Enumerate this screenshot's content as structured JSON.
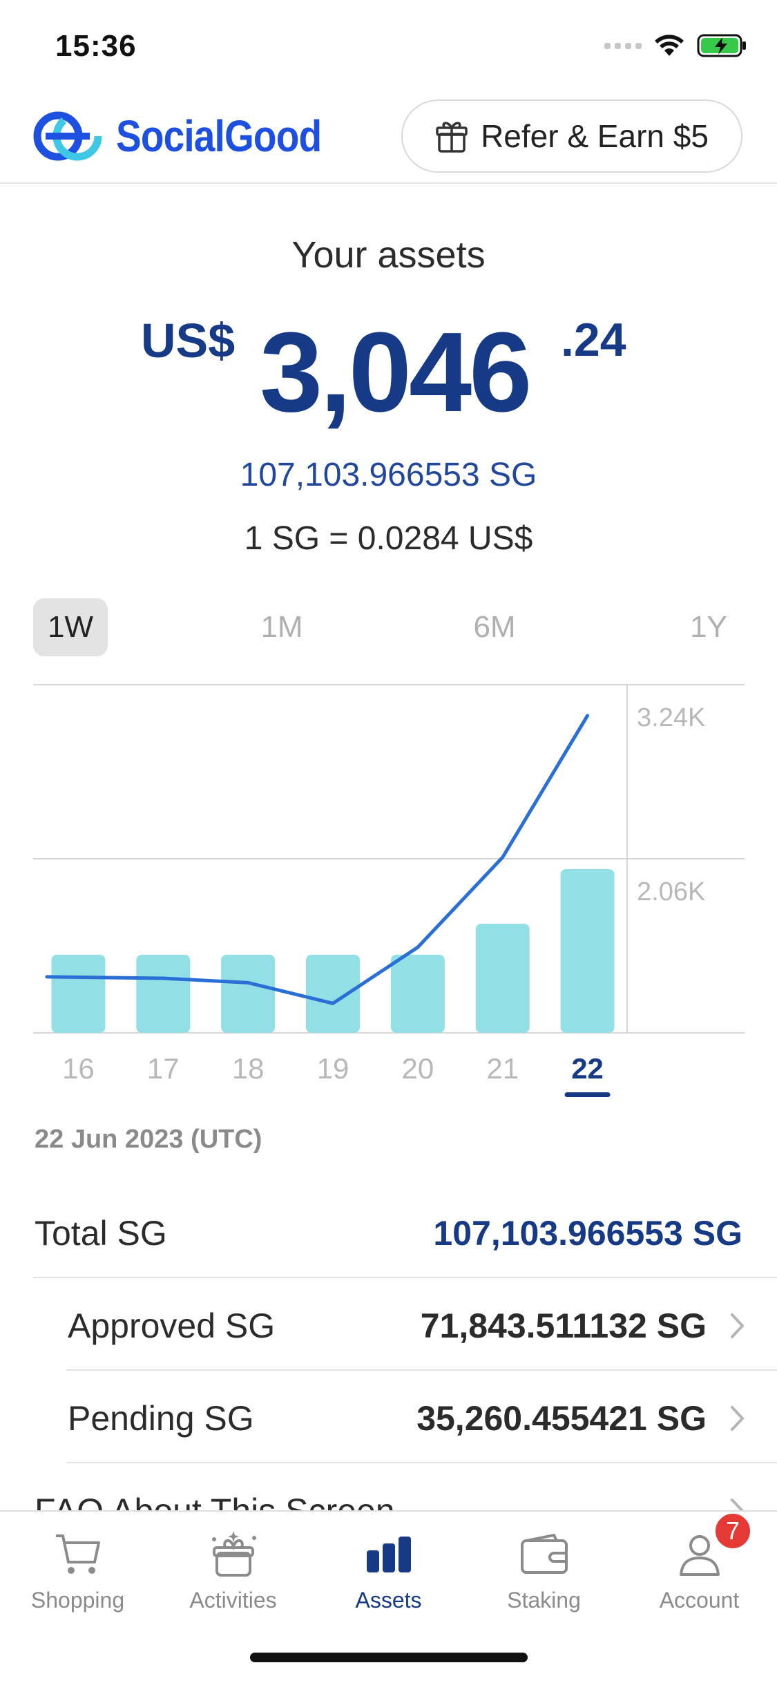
{
  "status_bar": {
    "time": "15:36"
  },
  "header": {
    "brand": "SocialGood",
    "refer_label": "Refer & Earn $5"
  },
  "assets": {
    "title": "Your assets",
    "currency": "US$",
    "amount_int": "3,046",
    "amount_dec": ".24",
    "sg_total": "107,103.966553 SG",
    "rate": "1 SG = 0.0284 US$"
  },
  "tabs": [
    {
      "label": "1W",
      "active": true
    },
    {
      "label": "1M",
      "active": false
    },
    {
      "label": "6M",
      "active": false
    },
    {
      "label": "1Y",
      "active": false
    }
  ],
  "chart_data": {
    "type": "bar",
    "categories": [
      "16",
      "17",
      "18",
      "19",
      "20",
      "21",
      "22"
    ],
    "selected_category": "22",
    "y_tick_labels": [
      "3.24K",
      "2.06K"
    ],
    "y_ticks": [
      3240,
      2060
    ],
    "ylim": [
      880,
      3240
    ],
    "series": [
      {
        "kind": "bar",
        "values": [
          1410,
          1410,
          1410,
          1410,
          1410,
          1620,
          1990
        ]
      },
      {
        "kind": "line",
        "values": [
          1260,
          1250,
          1220,
          1080,
          1460,
          2070,
          3030
        ]
      }
    ],
    "grid": true,
    "colors": {
      "bar": "#93dfe6",
      "line": "#2a6fd6",
      "selected_underline": "#173a86"
    }
  },
  "date_label": "22 Jun 2023 (UTC)",
  "rows": {
    "total": {
      "label": "Total SG",
      "value": "107,103.966553 SG"
    },
    "approved": {
      "label": "Approved SG",
      "value": "71,843.511132 SG"
    },
    "pending": {
      "label": "Pending SG",
      "value": "35,260.455421 SG"
    },
    "faq": {
      "label": "FAQ About This Screen"
    }
  },
  "nav": [
    {
      "label": "Shopping",
      "icon": "cart-icon",
      "active": false
    },
    {
      "label": "Activities",
      "icon": "gift-box-icon",
      "active": false
    },
    {
      "label": "Assets",
      "icon": "bar-chart-icon",
      "active": true
    },
    {
      "label": "Staking",
      "icon": "wallet-icon",
      "active": false
    },
    {
      "label": "Account",
      "icon": "user-icon",
      "active": false,
      "badge": "7"
    }
  ],
  "colors": {
    "brand": "#1d4fe0",
    "primary_text": "#173a86",
    "accent_cyan": "#3fc8e6"
  }
}
